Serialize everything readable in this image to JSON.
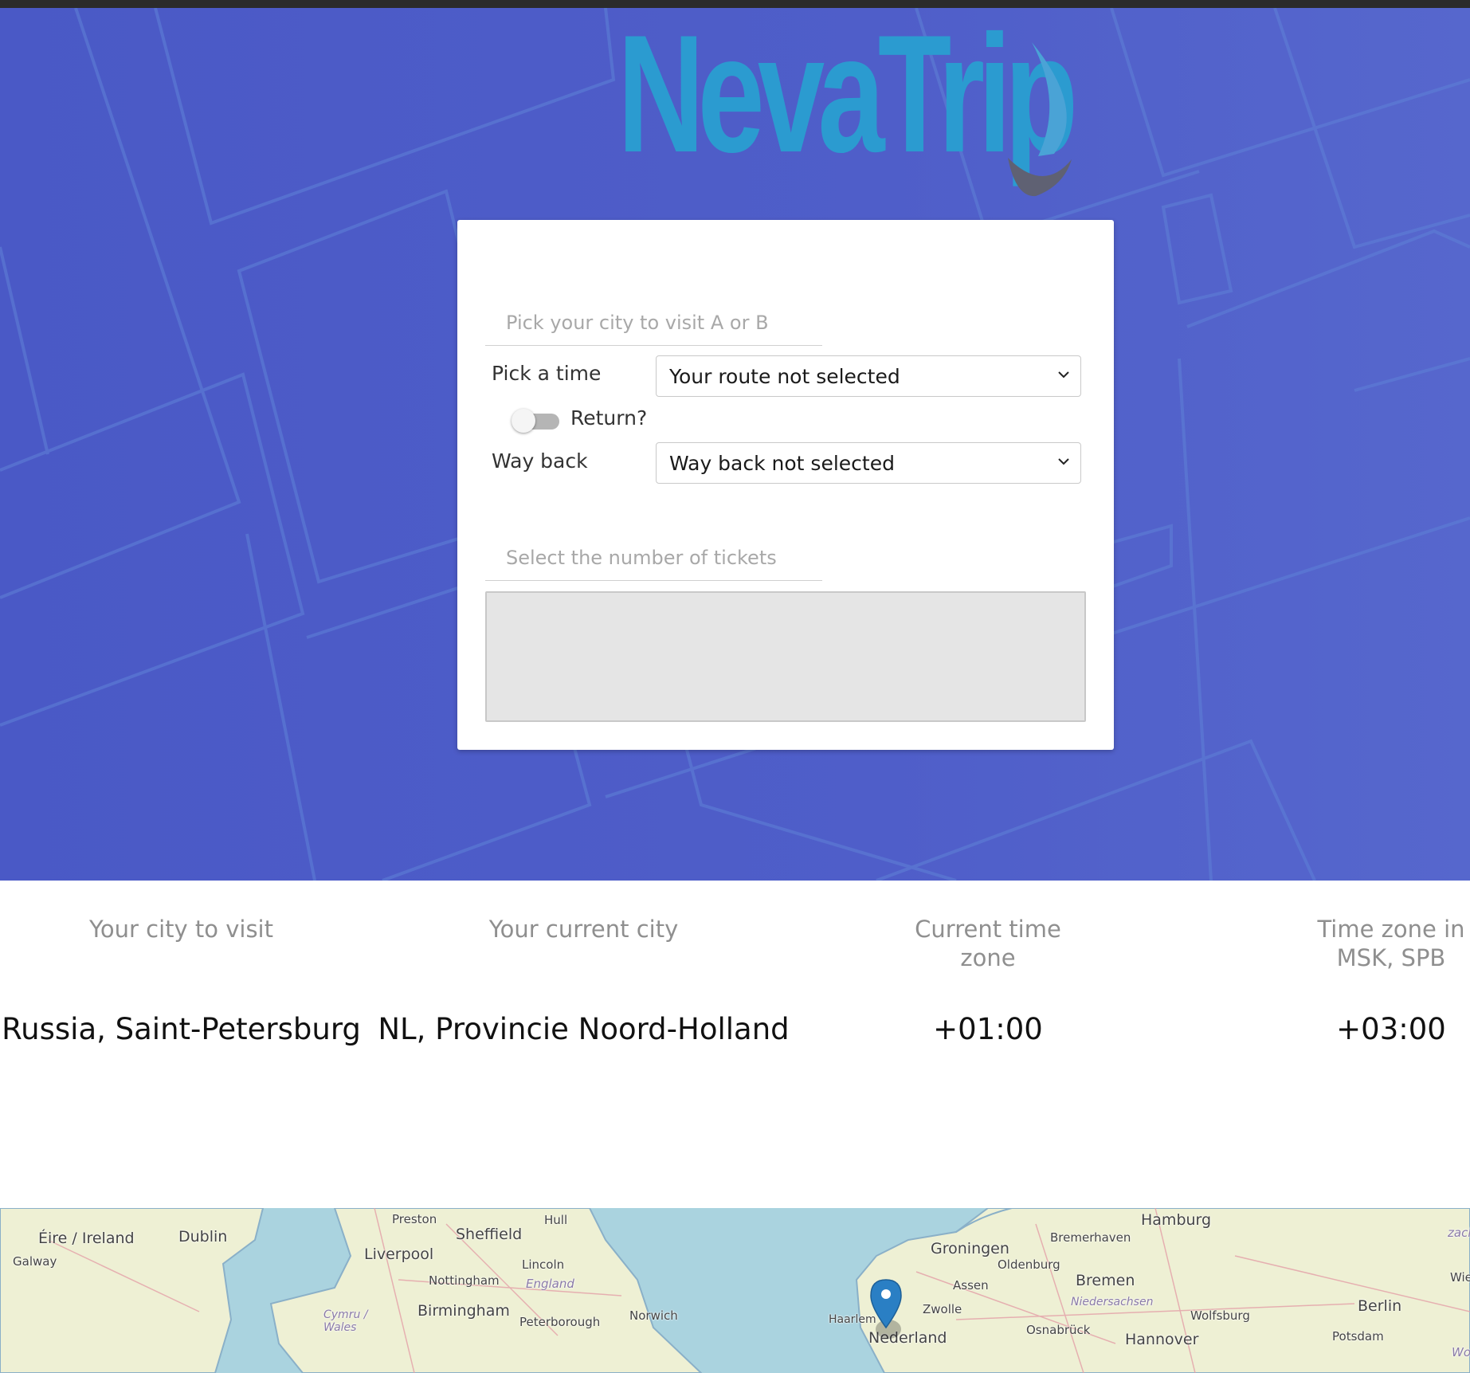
{
  "app": {
    "logo_text": "NevaTrip"
  },
  "booking_form": {
    "city_placeholder": "Pick your city to visit A or B",
    "time_label": "Pick a time",
    "time_select_value": "Your route not selected",
    "return_toggle_label": "Return?",
    "return_toggle_on": false,
    "way_back_label": "Way back",
    "way_back_select_value": "Way back not selected",
    "tickets_placeholder": "Select the number of tickets"
  },
  "info_table": {
    "headers": {
      "city_to_visit": "Your city to visit",
      "current_city": "Your current city",
      "current_tz_line1": "Current time",
      "current_tz_line2": "zone",
      "msk_tz_line1": "Time zone in",
      "msk_tz_line2": "MSK, SPB"
    },
    "values": {
      "city_to_visit": "Russia, Saint-Petersburg",
      "current_city": "NL, Provincie Noord-Holland",
      "current_tz": "+01:00",
      "msk_tz": "+03:00"
    }
  },
  "map": {
    "labels": {
      "ireland": "Éire / Ireland",
      "dublin": "Dublin",
      "galway": "Galway",
      "preston": "Preston",
      "sheffield": "Sheffield",
      "hull": "Hull",
      "liverpool": "Liverpool",
      "lincoln": "Lincoln",
      "nottingham": "Nottingham",
      "england": "England",
      "wales": "Cymru / Wales",
      "birmingham": "Birmingham",
      "peterborough": "Peterborough",
      "norwich": "Norwich",
      "groningen": "Groningen",
      "oldenburg": "Oldenburg",
      "assen": "Assen",
      "zwolle": "Zwolle",
      "haarlem": "Haarlem",
      "nederland": "Nederland",
      "hamburg": "Hamburg",
      "bremerhaven": "Bremerhaven",
      "bremen": "Bremen",
      "niedersachsen": "Niedersachsen",
      "osnabruck": "Osnabrück",
      "hannover": "Hannover",
      "wolfsburg": "Wolfsburg",
      "berlin": "Berlin",
      "potsdam": "Potsdam",
      "zach": "zach",
      "wie": "Wie",
      "wo": "Wo"
    },
    "marker_icon": "map-pin-icon",
    "colors": {
      "water": "#aad3df",
      "land": "#eef0d4",
      "marker": "#2a7fc4"
    }
  },
  "colors": {
    "hero_background": "#4f5ec9",
    "logo": "#2b9bd0"
  }
}
